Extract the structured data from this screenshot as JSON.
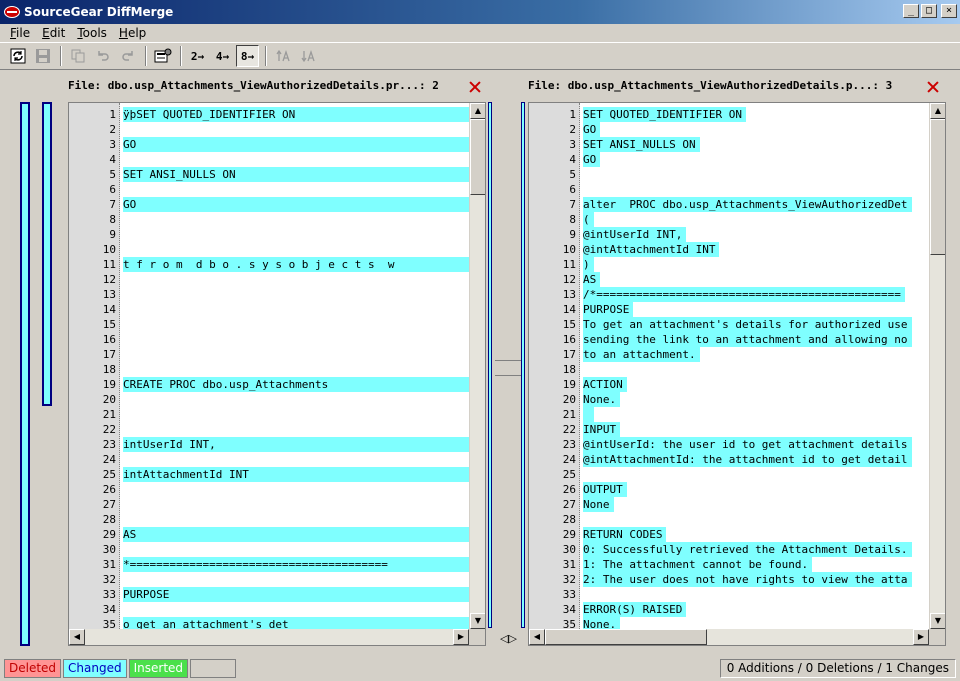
{
  "window": {
    "title": "SourceGear DiffMerge"
  },
  "menu": [
    {
      "label": "File",
      "ul": "F",
      "rest": "ile"
    },
    {
      "label": "Edit",
      "ul": "E",
      "rest": "dit"
    },
    {
      "label": "Tools",
      "ul": "T",
      "rest": "ools"
    },
    {
      "label": "Help",
      "ul": "H",
      "rest": "elp"
    }
  ],
  "toolbar": {
    "tab2": "2→",
    "tab4": "4→",
    "tab8": "8→"
  },
  "left_pane": {
    "header": "File: dbo.usp_Attachments_ViewAuthorizedDetails.pr...: 2",
    "lines": [
      {
        "n": "1",
        "t": "ÿþSET QUOTED_IDENTIFIER ON",
        "hl": true
      },
      {
        "n": "2",
        "t": "",
        "hl": true
      },
      {
        "n": "3",
        "t": "GO",
        "hl": true
      },
      {
        "n": "4",
        "t": "",
        "hl": true
      },
      {
        "n": "5",
        "t": "SET ANSI_NULLS ON",
        "hl": true
      },
      {
        "n": "6",
        "t": "",
        "hl": true
      },
      {
        "n": "7",
        "t": "GO",
        "hl": true
      },
      {
        "n": "8",
        "t": "",
        "hl": false
      },
      {
        "n": "9",
        "t": "",
        "hl": false
      },
      {
        "n": "10",
        "t": "",
        "hl": true
      },
      {
        "n": "11",
        "t": "t f r o m  d b o . s y s o b j e c t s  w",
        "hl": true
      },
      {
        "n": "12",
        "t": "",
        "hl": true
      },
      {
        "n": "13",
        "t": "",
        "hl": true
      },
      {
        "n": "14",
        "t": "",
        "hl": true
      },
      {
        "n": "15",
        "t": "",
        "hl": true
      },
      {
        "n": "16",
        "t": "",
        "hl": true
      },
      {
        "n": "17",
        "t": "",
        "hl": true
      },
      {
        "n": "18",
        "t": "",
        "hl": true
      },
      {
        "n": "19",
        "t": "CREATE PROC dbo.usp_Attachments",
        "hl": true
      },
      {
        "n": "20",
        "t": "",
        "hl": true
      },
      {
        "n": "21",
        "t": "",
        "hl": false
      },
      {
        "n": "22",
        "t": "",
        "hl": true
      },
      {
        "n": "23",
        "t": "intUserId INT,",
        "hl": true
      },
      {
        "n": "24",
        "t": "",
        "hl": true
      },
      {
        "n": "25",
        "t": "intAttachmentId INT",
        "hl": true
      },
      {
        "n": "26",
        "t": "",
        "hl": true
      },
      {
        "n": "27",
        "t": "",
        "hl": false
      },
      {
        "n": "28",
        "t": "",
        "hl": true
      },
      {
        "n": "29",
        "t": "AS",
        "hl": true
      },
      {
        "n": "30",
        "t": "",
        "hl": true
      },
      {
        "n": "31",
        "t": "*=======================================",
        "hl": true
      },
      {
        "n": "32",
        "t": "",
        "hl": true
      },
      {
        "n": "33",
        "t": "PURPOSE",
        "hl": true
      },
      {
        "n": "34",
        "t": "",
        "hl": true
      },
      {
        "n": "35",
        "t": "o get an attachment's det",
        "hl": true
      }
    ]
  },
  "right_pane": {
    "header": "File: dbo.usp_Attachments_ViewAuthorizedDetails.p...: 3",
    "lines": [
      {
        "n": "1",
        "t": "SET QUOTED_IDENTIFIER ON"
      },
      {
        "n": "2",
        "t": "GO"
      },
      {
        "n": "3",
        "t": "SET ANSI_NULLS ON"
      },
      {
        "n": "4",
        "t": "GO"
      },
      {
        "n": "5",
        "t": ""
      },
      {
        "n": "6",
        "t": ""
      },
      {
        "n": "7",
        "t": "alter  PROC dbo.usp_Attachments_ViewAuthorizedDet"
      },
      {
        "n": "8",
        "t": "("
      },
      {
        "n": "9",
        "t": "@intUserId INT,"
      },
      {
        "n": "10",
        "t": "@intAttachmentId INT"
      },
      {
        "n": "11",
        "t": ")"
      },
      {
        "n": "12",
        "t": "AS"
      },
      {
        "n": "13",
        "t": "/*=============================================="
      },
      {
        "n": "14",
        "t": "PURPOSE"
      },
      {
        "n": "15",
        "t": "To get an attachment's details for authorized use"
      },
      {
        "n": "16",
        "t": "sending the link to an attachment and allowing no"
      },
      {
        "n": "17",
        "t": "to an attachment."
      },
      {
        "n": "18",
        "t": ""
      },
      {
        "n": "19",
        "t": "ACTION"
      },
      {
        "n": "20",
        "t": "None."
      },
      {
        "n": "21",
        "t": " "
      },
      {
        "n": "22",
        "t": "INPUT"
      },
      {
        "n": "23",
        "t": "@intUserId: the user id to get attachment details"
      },
      {
        "n": "24",
        "t": "@intAttachmentId: the attachment id to get detail"
      },
      {
        "n": "25",
        "t": ""
      },
      {
        "n": "26",
        "t": "OUTPUT"
      },
      {
        "n": "27",
        "t": "None"
      },
      {
        "n": "28",
        "t": ""
      },
      {
        "n": "29",
        "t": "RETURN CODES"
      },
      {
        "n": "30",
        "t": "0: Successfully retrieved the Attachment Details."
      },
      {
        "n": "31",
        "t": "1: The attachment cannot be found."
      },
      {
        "n": "32",
        "t": "2: The user does not have rights to view the atta"
      },
      {
        "n": "33",
        "t": ""
      },
      {
        "n": "34",
        "t": "ERROR(S) RAISED"
      },
      {
        "n": "35",
        "t": "None."
      }
    ]
  },
  "status": {
    "deleted": "Deleted",
    "changed": "Changed",
    "inserted": "Inserted",
    "summary": "0 Additions / 0 Deletions / 1 Changes"
  },
  "colors": {
    "changed": "#7fffff",
    "deleted": "#ff9494",
    "inserted": "#4be04b",
    "title_bar": "#0a246a"
  }
}
